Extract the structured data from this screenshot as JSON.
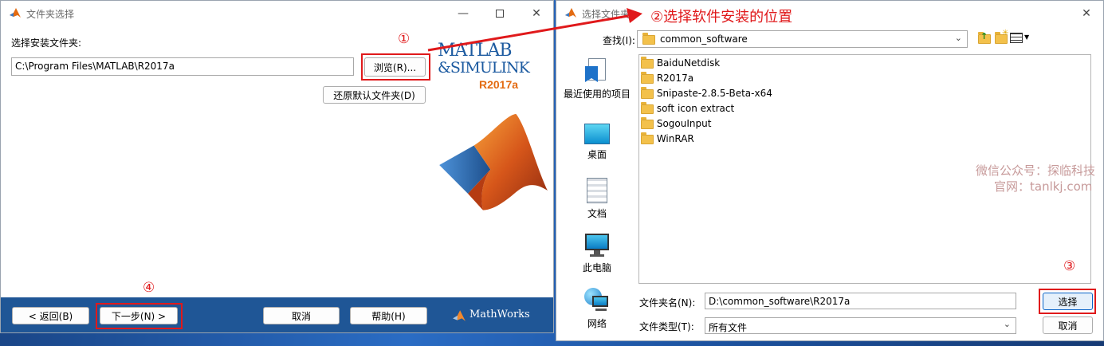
{
  "left_window": {
    "title": "文件夹选择",
    "folder_label": "选择安装文件夹:",
    "path_value": "C:\\Program Files\\MATLAB\\R2017a",
    "browse_label": "浏览(R)...",
    "restore_label": "还原默认文件夹(D)",
    "brand_line1": "MATLAB",
    "brand_line2": "&SIMULINK",
    "brand_release": "R2017a",
    "back_label": "< 返回(B)",
    "next_label": "下一步(N) >",
    "cancel_label": "取消",
    "help_label": "帮助(H)",
    "mathworks_label": "MathWorks",
    "icons": [
      "matlab-logo-icon",
      "minimize-icon",
      "maximize-icon",
      "close-icon",
      "membrane-logo-icon",
      "mathworks-logo-icon"
    ]
  },
  "right_window": {
    "title": "选择文件夹",
    "lookin_label": "查找(I):",
    "lookin_value": "common_software",
    "places": [
      {
        "label": "最近使用的项目",
        "icon": "recent-items-icon"
      },
      {
        "label": "桌面",
        "icon": "desktop-icon"
      },
      {
        "label": "文档",
        "icon": "documents-icon"
      },
      {
        "label": "此电脑",
        "icon": "computer-icon"
      },
      {
        "label": "网络",
        "icon": "network-icon"
      }
    ],
    "files": [
      "BaiduNetdisk",
      "R2017a",
      "Snipaste-2.8.5-Beta-x64",
      "soft icon extract",
      "SogouInput",
      "WinRAR"
    ],
    "foldername_label": "文件夹名(N):",
    "foldername_value": "D:\\common_software\\R2017a",
    "filetype_label": "文件类型(T):",
    "filetype_value": "所有文件",
    "select_label": "选择",
    "cancel_label": "取消"
  },
  "annotations": {
    "step1": "①",
    "step2": "②选择软件安装的位置",
    "step3": "③",
    "step4": "④"
  },
  "watermark": {
    "line1": "微信公众号：探临科技",
    "line2": "官网：tanlkj.com"
  },
  "colors": {
    "annotation_red": "#e0191b",
    "footer_blue": "#1f5696",
    "matlab_orange": "#e36b12"
  }
}
